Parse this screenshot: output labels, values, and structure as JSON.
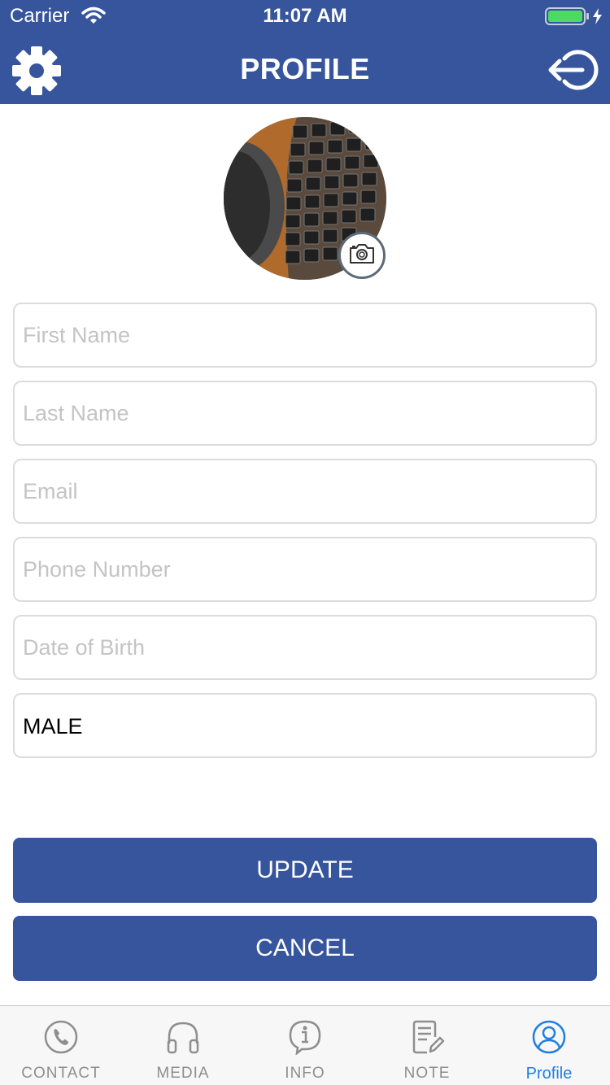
{
  "status_bar": {
    "carrier": "Carrier",
    "time": "11:07 AM"
  },
  "header": {
    "title": "PROFILE",
    "left_icon": "gear-icon",
    "right_icon": "logout-icon"
  },
  "avatar": {
    "camera_icon": "camera-icon"
  },
  "form": {
    "first_name": {
      "placeholder": "First Name",
      "value": ""
    },
    "last_name": {
      "placeholder": "Last Name",
      "value": ""
    },
    "email": {
      "placeholder": "Email",
      "value": ""
    },
    "phone": {
      "placeholder": "Phone Number",
      "value": ""
    },
    "dob": {
      "placeholder": "Date of Birth",
      "value": ""
    },
    "gender": {
      "value": "MALE"
    }
  },
  "buttons": {
    "update": "UPDATE",
    "cancel": "CANCEL"
  },
  "tabs": [
    {
      "label": "CONTACT",
      "icon": "phone-icon"
    },
    {
      "label": "MEDIA",
      "icon": "headphones-icon"
    },
    {
      "label": "INFO",
      "icon": "info-icon"
    },
    {
      "label": "NOTE",
      "icon": "note-icon"
    },
    {
      "label": "Profile",
      "icon": "user-icon"
    }
  ],
  "colors": {
    "brand": "#36559c",
    "active_tab": "#1f7fe0",
    "inactive_tab": "#8e8e8e",
    "battery": "#4cd964"
  }
}
